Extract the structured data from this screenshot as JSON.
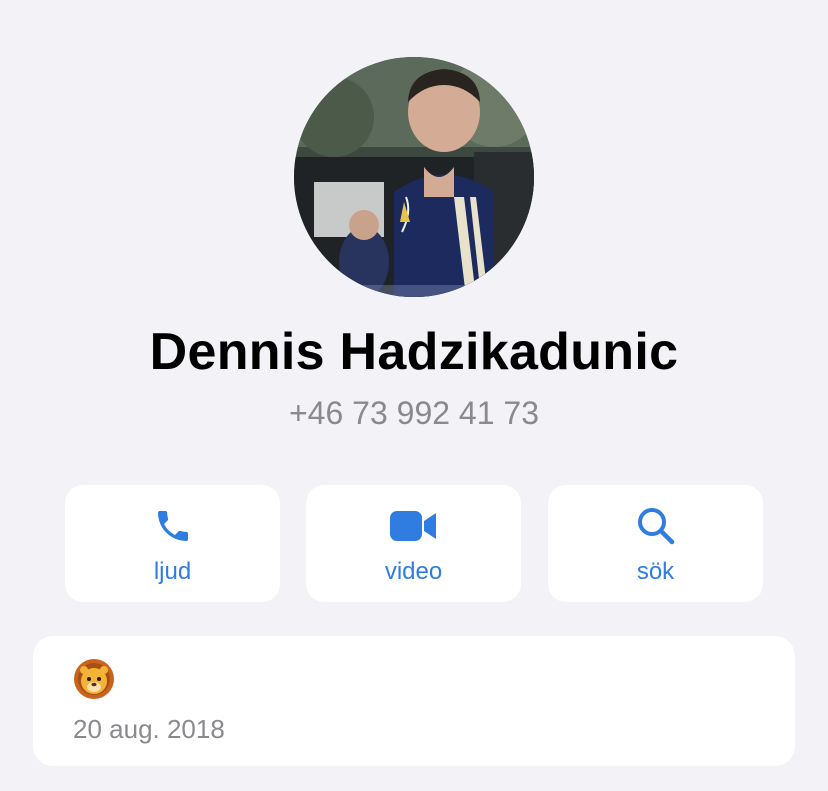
{
  "contact": {
    "name": "Dennis Hadzikadunic",
    "phone": "+46 73 992 41 73"
  },
  "actions": [
    {
      "label": "ljud",
      "icon": "phone-icon"
    },
    {
      "label": "video",
      "icon": "video-camera-icon"
    },
    {
      "label": "sök",
      "icon": "search-icon"
    }
  ],
  "info": {
    "emoji": "lion-face-icon",
    "date": "20 aug. 2018"
  },
  "colors": {
    "background": "#f2f2f7",
    "accent": "#2f7de1",
    "secondary_text": "#8a8a8e"
  }
}
